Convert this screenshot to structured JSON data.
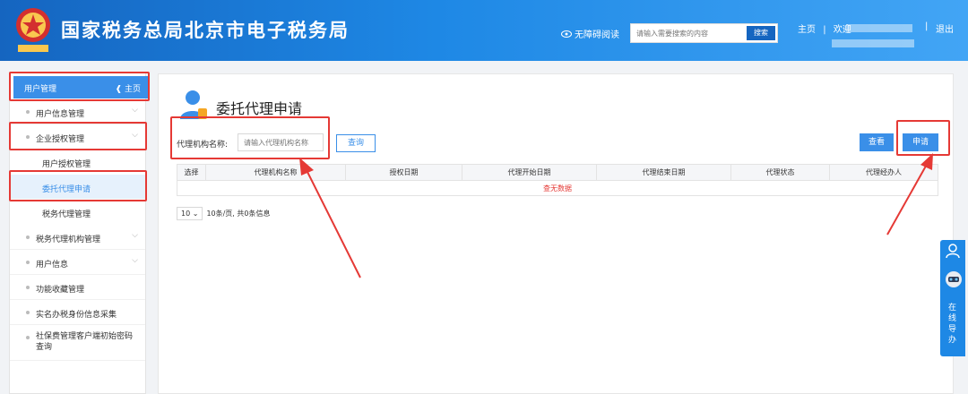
{
  "header": {
    "title": "国家税务总局北京市电子税务局",
    "accessibility": "无障碍阅读",
    "search_placeholder": "请输入需要搜索的内容",
    "search_button": "搜索",
    "home_link": "主页",
    "welcome": "欢迎",
    "logout": "退出",
    "separator": "|"
  },
  "sidebar": {
    "header_label": "用户管理",
    "home_label": "主页",
    "items": [
      {
        "label": "用户信息管理",
        "has_children": true
      },
      {
        "label": "企业授权管理",
        "has_children": true
      },
      {
        "label": "税务代理机构管理",
        "has_children": true
      },
      {
        "label": "用户信息",
        "has_children": true
      },
      {
        "label": "功能收藏管理",
        "has_children": false
      },
      {
        "label": "实名办税身份信息采集",
        "has_children": false
      },
      {
        "label": "社保费管理客户端初始密码查询",
        "has_children": false
      }
    ],
    "subitems": [
      {
        "label": "用户授权管理",
        "active": false
      },
      {
        "label": "委托代理申请",
        "active": true
      },
      {
        "label": "税务代理管理",
        "active": false
      }
    ]
  },
  "main": {
    "page_title": "委托代理申请",
    "field_label": "代理机构名称:",
    "field_placeholder": "请输入代理机构名称",
    "query_button": "查询",
    "view_button": "查看",
    "apply_button": "申请",
    "table": {
      "columns": [
        "选择",
        "代理机构名称",
        "授权日期",
        "代理开始日期",
        "代理结束日期",
        "代理状态",
        "代理经办人"
      ],
      "empty_text": "查无数据"
    },
    "pager": {
      "page_size": "10",
      "summary": "10条/页, 共0条信息"
    }
  },
  "float_widget": {
    "label": "在线导办"
  },
  "colors": {
    "header_start": "#1565c0",
    "accent": "#3a8fe8",
    "highlight": "#e53935"
  }
}
